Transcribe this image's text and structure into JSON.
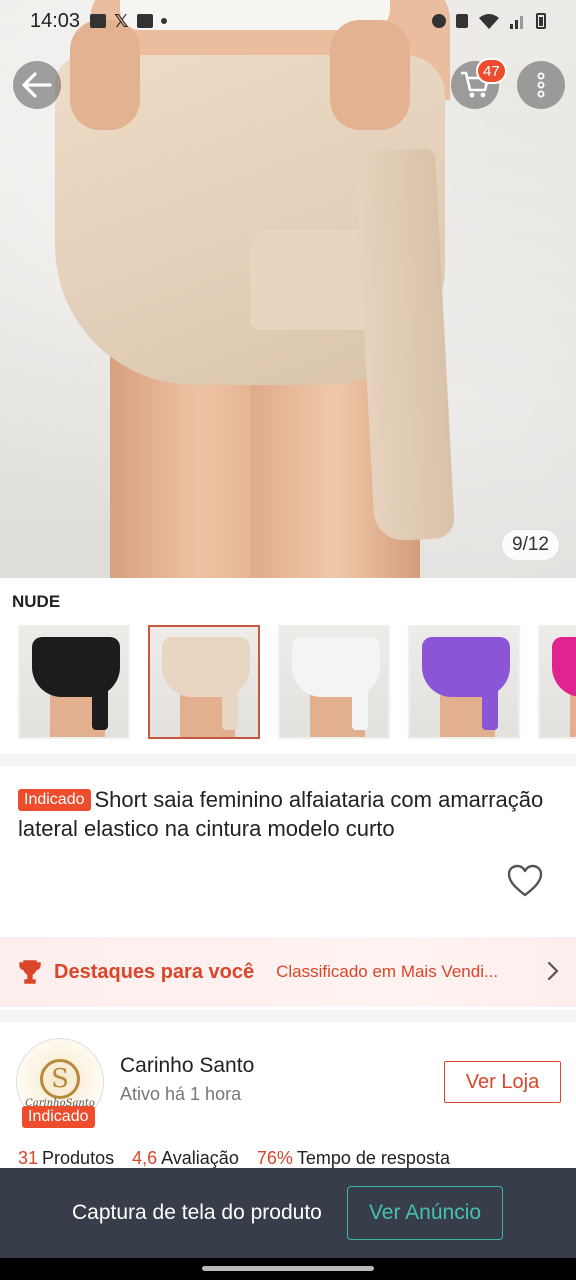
{
  "status_bar": {
    "time": "14:03"
  },
  "hero": {
    "image_counter": "9/12"
  },
  "cart": {
    "count": "47"
  },
  "variation": {
    "label": "NUDE",
    "thumbnails": [
      {
        "color": "#1c1c1c"
      },
      {
        "color": "#e8d6c2"
      },
      {
        "color": "#f4f4f7"
      },
      {
        "color": "#8a55d6"
      },
      {
        "color": "#e0248f"
      }
    ]
  },
  "product": {
    "tag": "Indicado",
    "title": "Short saia feminino alfaiataria com amarração lateral elastico na cintura modelo curto"
  },
  "highlights": {
    "title": "Destaques para você",
    "subtitle": "Classificado em Mais Vendi..."
  },
  "shop": {
    "name": "Carinho Santo",
    "active_status": "Ativo há 1 hora",
    "badge": "Indicado",
    "logo_text": "CarinhoSanto",
    "visit_label": "Ver Loja",
    "stats": [
      {
        "value": "31",
        "label": "Produtos"
      },
      {
        "value": "4,6",
        "label": "Avaliação"
      },
      {
        "value": "76%",
        "label": "Tempo de resposta"
      }
    ]
  },
  "overlay": {
    "message": "Captura de tela do produto",
    "button_label": "Ver Anúncio"
  },
  "colors": {
    "accent": "#ee4d2d",
    "accent_text": "#d9462a",
    "overlay_bg": "#383d4a",
    "overlay_button": "#45c0b2"
  }
}
